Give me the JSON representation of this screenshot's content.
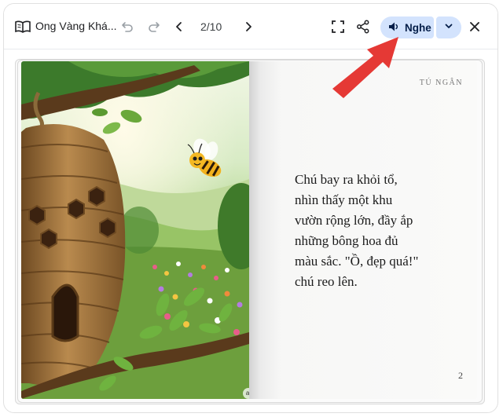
{
  "toolbar": {
    "book_title": "Ong Vàng Khá...",
    "page_indicator": "2/10",
    "listen_label": "Nghe",
    "icons": {
      "book": "book-open-icon",
      "undo": "undo-icon",
      "redo": "redo-icon",
      "prev": "chevron-left-icon",
      "next": "chevron-right-icon",
      "fullscreen": "fullscreen-icon",
      "share": "share-icon",
      "speaker": "volume-icon",
      "dropdown": "chevron-down-icon",
      "close": "close-icon"
    }
  },
  "annotation": {
    "arrow_color": "#e53935"
  },
  "book": {
    "left_page": {
      "illustration": "bee-flying-from-hive-over-flower-meadow",
      "badge": "ai"
    },
    "right_page": {
      "author": "TÚ NGÂN",
      "text_lines": [
        "Chú bay ra khỏi tổ,",
        "nhìn thấy một khu",
        "vườn rộng lớn, đầy ắp",
        "những bông hoa đủ",
        "màu sắc. \"Ồ, đẹp quá!\"",
        "chú reo lên."
      ],
      "page_number": "2"
    }
  },
  "colors": {
    "listen_bg": "#d3e3fd",
    "listen_text": "#041e49"
  }
}
